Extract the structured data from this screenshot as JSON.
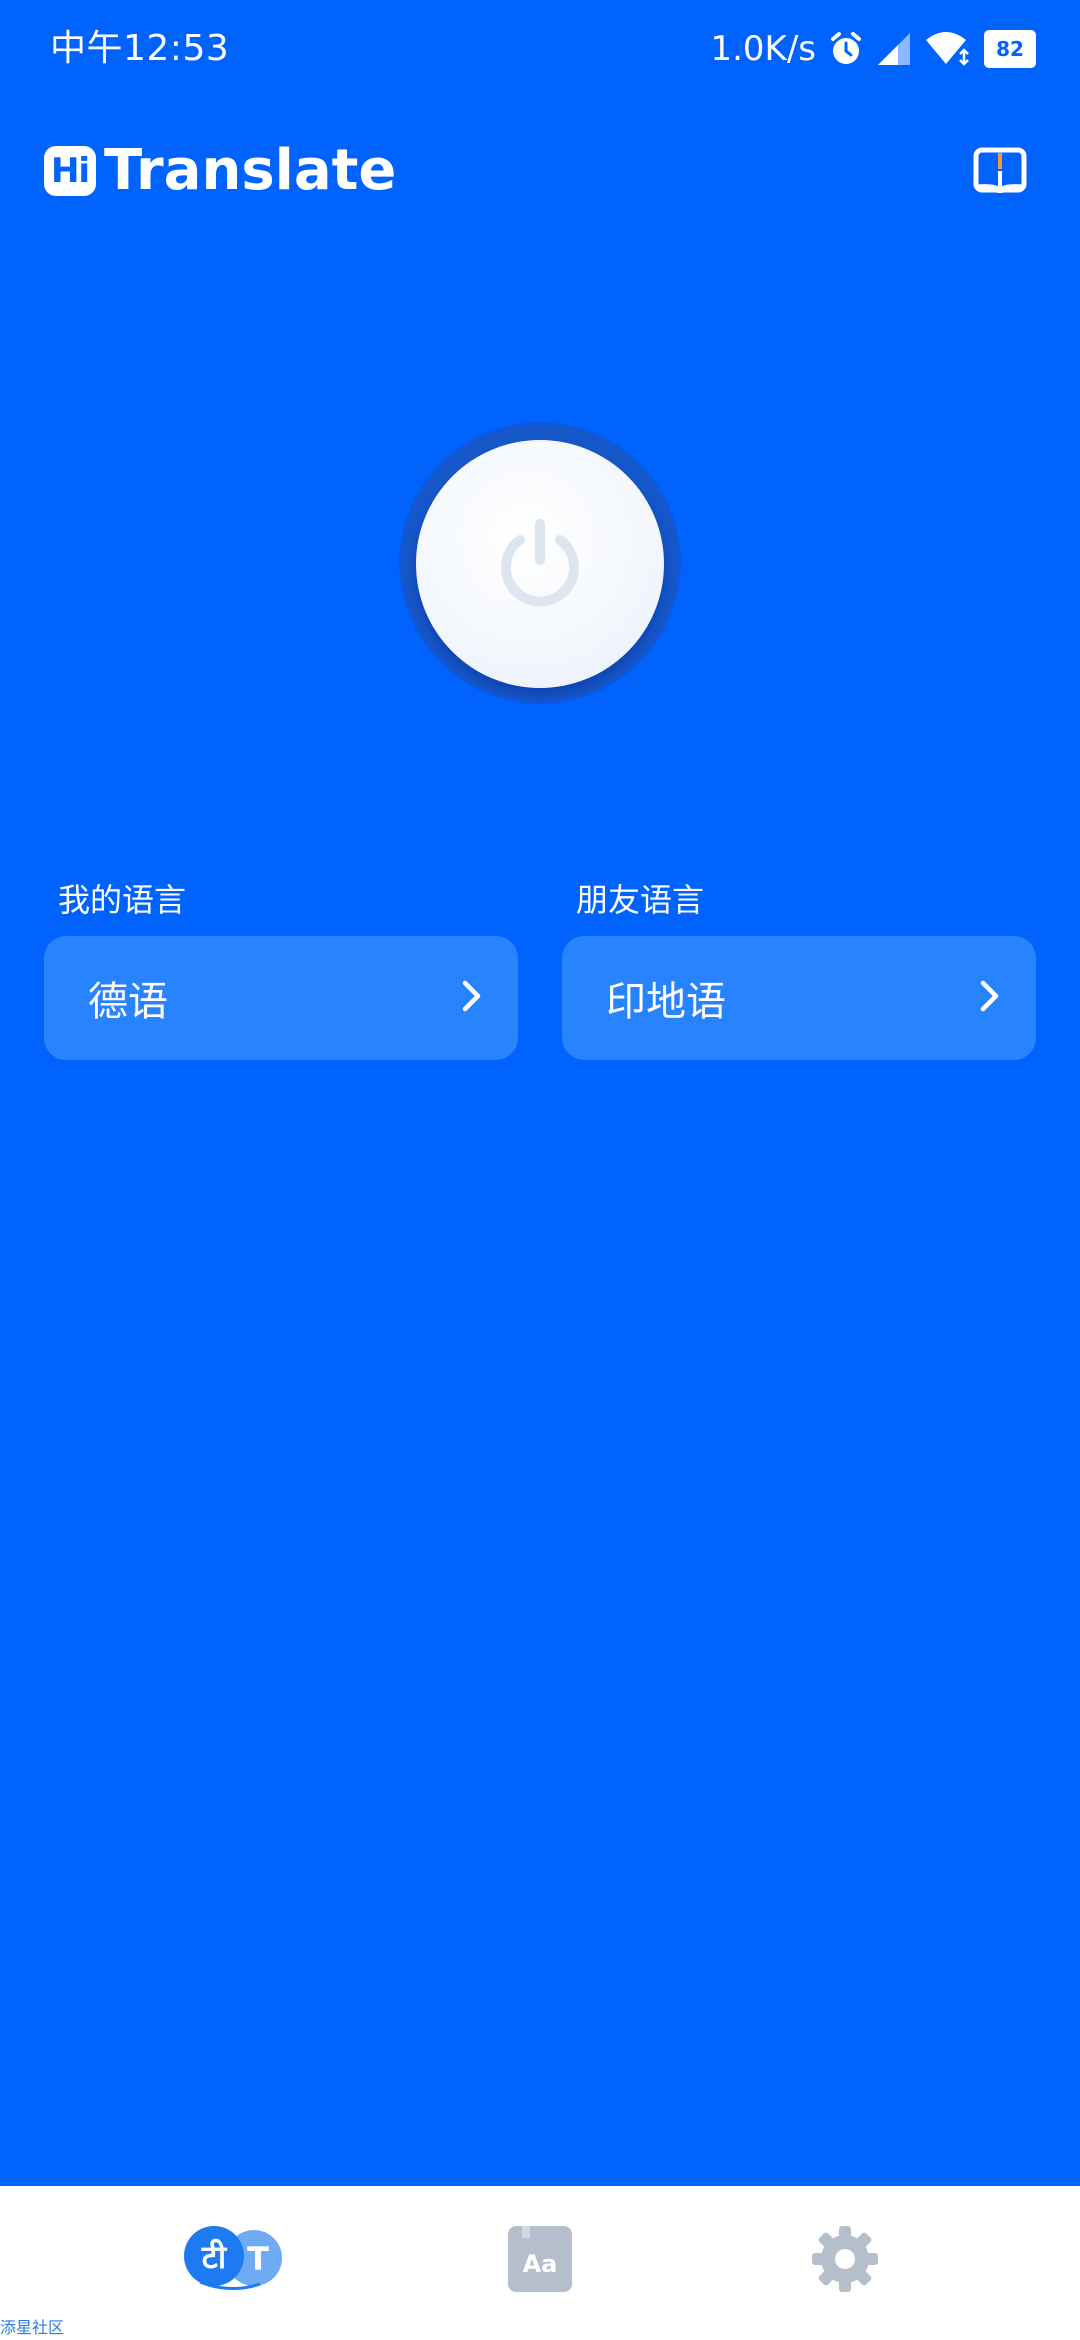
{
  "status_bar": {
    "time": "中午12:53",
    "net_speed": "1.0K/s",
    "battery": "82",
    "icons": [
      "alarm-icon",
      "signal-icon",
      "wifi-icon",
      "battery-icon"
    ]
  },
  "header": {
    "logo_badge": "Hi",
    "logo_text": "Translate",
    "book_icon": "book-icon"
  },
  "power": {
    "icon": "power-icon"
  },
  "languages": {
    "my": {
      "label": "我的语言",
      "value": "德语"
    },
    "friend": {
      "label": "朋友语言",
      "value": "印地语"
    }
  },
  "bottom_nav": {
    "items": [
      {
        "icon": "translate-icon",
        "glyph_left": "टी",
        "glyph_right": "T",
        "active": true
      },
      {
        "icon": "dictionary-icon",
        "glyph": "Aa",
        "active": false
      },
      {
        "icon": "settings-icon",
        "active": false
      }
    ]
  },
  "watermark": "添星社区",
  "colors": {
    "background": "#0163FE",
    "card": "#2783FE",
    "nav_background": "#FFFFFF",
    "nav_inactive": "#B5BFCC",
    "translate_dark": "#1D7AF0",
    "translate_light": "#6FAAF5"
  }
}
